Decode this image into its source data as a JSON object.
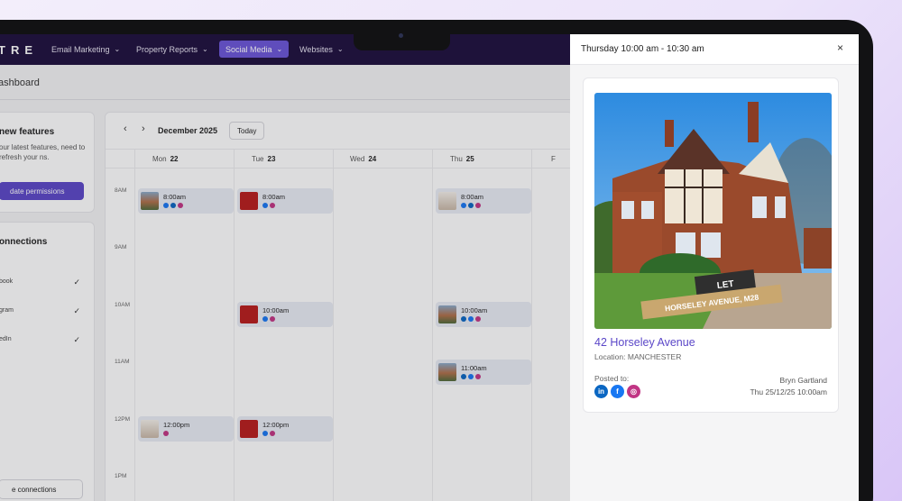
{
  "nav": {
    "logo": "TRE",
    "items": [
      {
        "label": "Email Marketing",
        "active": false
      },
      {
        "label": "Property Reports",
        "active": false
      },
      {
        "label": "Social Media",
        "active": true
      },
      {
        "label": "Websites",
        "active": false
      }
    ]
  },
  "page": {
    "title": "ashboard"
  },
  "features": {
    "title": "new features",
    "body": "our latest features, need to refresh your ns.",
    "button": "date permissions"
  },
  "connections": {
    "title": "onnections",
    "items": [
      "book",
      "gram",
      "edIn"
    ],
    "manage_button": "e connections"
  },
  "calendar": {
    "month": "December 2025",
    "today": "Today",
    "days": [
      {
        "name": "Mon",
        "num": "22"
      },
      {
        "name": "Tue",
        "num": "23"
      },
      {
        "name": "Wed",
        "num": "24"
      },
      {
        "name": "Thu",
        "num": "25"
      },
      {
        "name": "F",
        "num": ""
      }
    ],
    "times": [
      "8AM",
      "9AM",
      "10AM",
      "11AM",
      "12PM",
      "1PM"
    ],
    "events": [
      {
        "time": "8:00am",
        "thumb": "house"
      },
      {
        "time": "8:00am",
        "thumb": "red"
      },
      {
        "time": "8:00am",
        "thumb": "light"
      },
      {
        "time": "10:00am",
        "thumb": "red"
      },
      {
        "time": "10:00am",
        "thumb": "house"
      },
      {
        "time": "11:00am",
        "thumb": "house"
      },
      {
        "time": "12:00pm",
        "thumb": "light"
      },
      {
        "time": "12:00pm",
        "thumb": "red"
      }
    ]
  },
  "panel": {
    "title": "Thursday 10:00 am - 10:30 am",
    "close": "×",
    "property_title": "42 Horseley Avenue",
    "location": "Location: MANCHESTER",
    "posted_label": "Posted to:",
    "author": "Bryn Gartland",
    "posted_at": "Thu 25/12/25 10:00am",
    "sign_status": "LET",
    "sign_address": "HORSELEY AVENUE, M28",
    "socials": [
      {
        "icon": "linkedin-icon",
        "glyph": "in",
        "color": "#0a66c2"
      },
      {
        "icon": "facebook-icon",
        "glyph": "f",
        "color": "#1877f2"
      },
      {
        "icon": "instagram-icon",
        "glyph": "◎",
        "color": "#c13584"
      }
    ]
  },
  "colors": {
    "nav_bg": "#1d0f3d",
    "accent": "#5b47c8",
    "event_bg": "#e9ecf5"
  }
}
